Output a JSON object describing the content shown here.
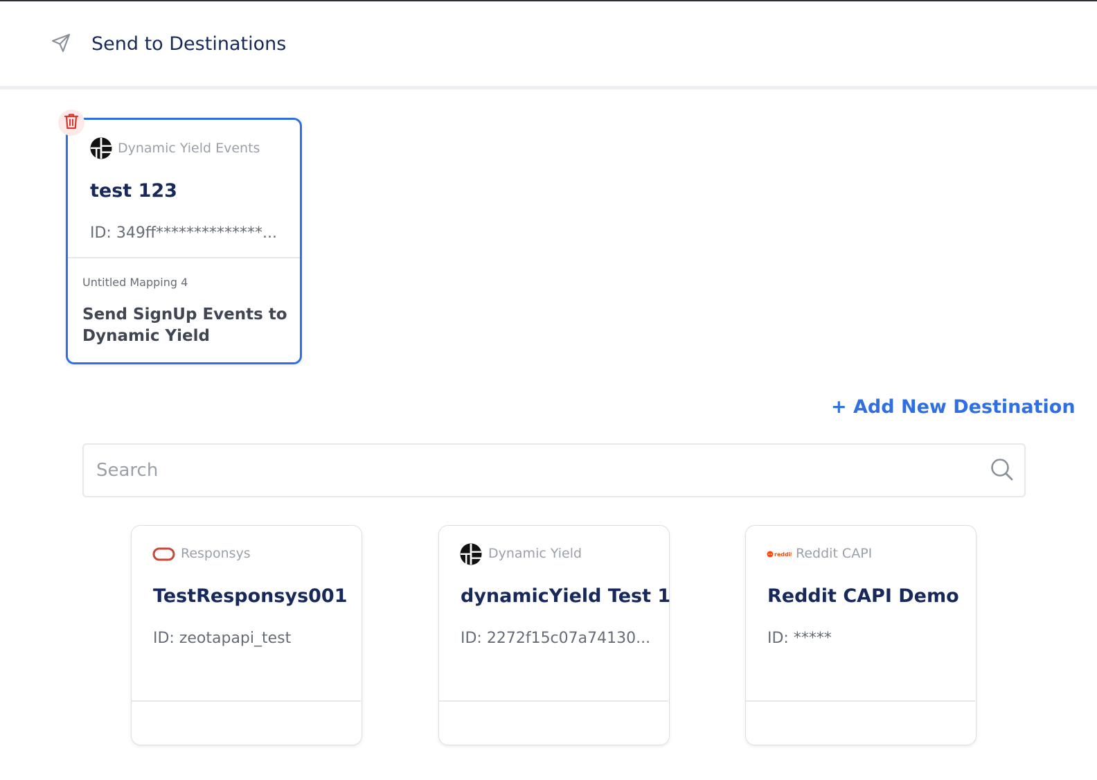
{
  "header": {
    "title": "Send to Destinations",
    "icon": "send-icon"
  },
  "selected_destination": {
    "type": "Dynamic Yield Events",
    "name": "test 123",
    "id": "ID: 349ff**************...",
    "mapping_label": "Untitled Mapping 4",
    "mapping_title": "Send SignUp Events to Dynamic Yield",
    "delete_icon": "trash-icon",
    "accent_color": "#2f6fe4"
  },
  "actions": {
    "add_destination": "+ Add New Destination"
  },
  "search": {
    "placeholder": "Search",
    "value": ""
  },
  "destinations": [
    {
      "type": "Responsys",
      "name": "TestResponsys001",
      "id": "ID: zeotapapi_test",
      "logo": "oracle-logo"
    },
    {
      "type": "Dynamic Yield",
      "name": "dynamicYield Test 1",
      "id": "ID: 2272f15c07a74130...",
      "logo": "dynamic-yield-logo"
    },
    {
      "type": "Reddit CAPI",
      "name": "Reddit CAPI Demo",
      "id": "ID: *****",
      "logo": "reddit-logo",
      "logo_text": "reddit"
    }
  ]
}
